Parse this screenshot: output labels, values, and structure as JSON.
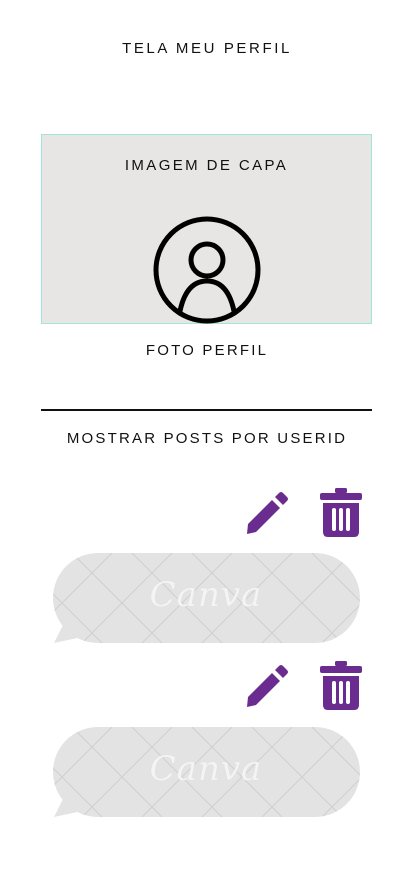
{
  "header": {
    "title": "TELA MEU PERFIL"
  },
  "profile": {
    "cover_label": "IMAGEM DE CAPA",
    "photo_label": "FOTO PERFIL"
  },
  "posts_section": {
    "label": "MOSTRAR POSTS POR USERID"
  },
  "posts": [
    {
      "watermark": "Canva",
      "edit_icon": "pencil-icon",
      "delete_icon": "trash-icon"
    },
    {
      "watermark": "Canva",
      "edit_icon": "pencil-icon",
      "delete_icon": "trash-icon"
    }
  ],
  "colors": {
    "accent": "#6a2d8f",
    "cover_bg": "#e8e6e4",
    "bubble_bg": "#e3e3e3",
    "cover_border": "#9fe7d9"
  }
}
